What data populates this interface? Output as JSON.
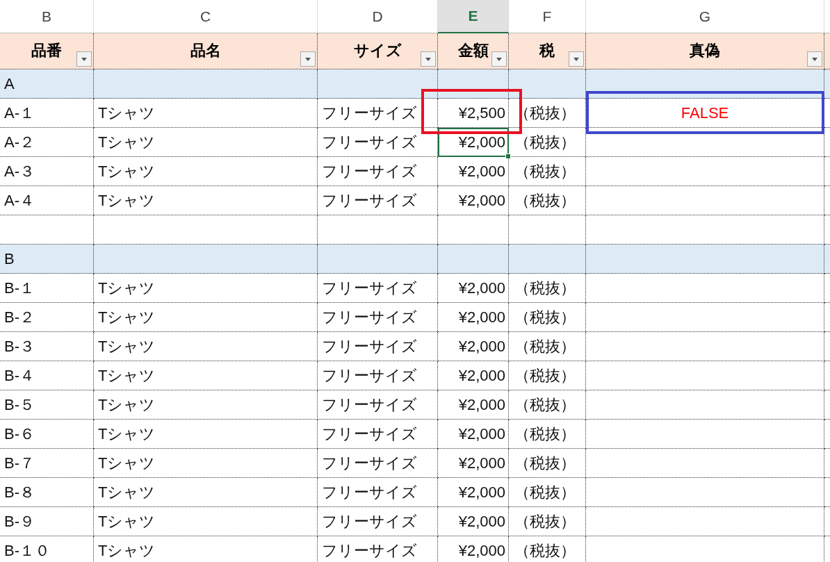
{
  "column_letters": [
    {
      "label": "B",
      "selected": false
    },
    {
      "label": "C",
      "selected": false
    },
    {
      "label": "D",
      "selected": false
    },
    {
      "label": "E",
      "selected": true
    },
    {
      "label": "F",
      "selected": false
    },
    {
      "label": "G",
      "selected": false
    }
  ],
  "headers": [
    {
      "label": "品番",
      "filter": true
    },
    {
      "label": "品名",
      "filter": true
    },
    {
      "label": "サイズ",
      "filter": true
    },
    {
      "label": "金額",
      "filter": true
    },
    {
      "label": "税",
      "filter": true
    },
    {
      "label": "真偽",
      "filter": true
    }
  ],
  "rows": [
    {
      "kind": "group",
      "label": "A"
    },
    {
      "kind": "item",
      "code": "A-１",
      "name": "Tシャツ",
      "size": "フリーサイズ",
      "price": "¥2,500",
      "tax": "（税抜）",
      "truth": "FALSE",
      "price_selected": false,
      "price_frame": true,
      "truth_frame": true
    },
    {
      "kind": "item",
      "code": "A-２",
      "name": "Tシャツ",
      "size": "フリーサイズ",
      "price": "¥2,000",
      "tax": "（税抜）",
      "price_selected": true,
      "price_frame": false,
      "truth_frame": false
    },
    {
      "kind": "item",
      "code": "A-３",
      "name": "Tシャツ",
      "size": "フリーサイズ",
      "price": "¥2,000",
      "tax": "（税抜）",
      "price_selected": false,
      "price_frame": false,
      "truth_frame": false
    },
    {
      "kind": "item",
      "code": "A-４",
      "name": "Tシャツ",
      "size": "フリーサイズ",
      "price": "¥2,000",
      "tax": "（税抜）",
      "price_selected": false,
      "price_frame": false,
      "truth_frame": false
    },
    {
      "kind": "blank"
    },
    {
      "kind": "group",
      "label": "B"
    },
    {
      "kind": "item",
      "code": "B-１",
      "name": "Tシャツ",
      "size": "フリーサイズ",
      "price": "¥2,000",
      "tax": "（税抜）",
      "price_selected": false,
      "price_frame": false,
      "truth_frame": false
    },
    {
      "kind": "item",
      "code": "B-２",
      "name": "Tシャツ",
      "size": "フリーサイズ",
      "price": "¥2,000",
      "tax": "（税抜）",
      "price_selected": false,
      "price_frame": false,
      "truth_frame": false
    },
    {
      "kind": "item",
      "code": "B-３",
      "name": "Tシャツ",
      "size": "フリーサイズ",
      "price": "¥2,000",
      "tax": "（税抜）",
      "price_selected": false,
      "price_frame": false,
      "truth_frame": false
    },
    {
      "kind": "item",
      "code": "B-４",
      "name": "Tシャツ",
      "size": "フリーサイズ",
      "price": "¥2,000",
      "tax": "（税抜）",
      "price_selected": false,
      "price_frame": false,
      "truth_frame": false
    },
    {
      "kind": "item",
      "code": "B-５",
      "name": "Tシャツ",
      "size": "フリーサイズ",
      "price": "¥2,000",
      "tax": "（税抜）",
      "price_selected": false,
      "price_frame": false,
      "truth_frame": false
    },
    {
      "kind": "item",
      "code": "B-６",
      "name": "Tシャツ",
      "size": "フリーサイズ",
      "price": "¥2,000",
      "tax": "（税抜）",
      "price_selected": false,
      "price_frame": false,
      "truth_frame": false
    },
    {
      "kind": "item",
      "code": "B-７",
      "name": "Tシャツ",
      "size": "フリーサイズ",
      "price": "¥2,000",
      "tax": "（税抜）",
      "price_selected": false,
      "price_frame": false,
      "truth_frame": false
    },
    {
      "kind": "item",
      "code": "B-８",
      "name": "Tシャツ",
      "size": "フリーサイズ",
      "price": "¥2,000",
      "tax": "（税抜）",
      "price_selected": false,
      "price_frame": false,
      "truth_frame": false
    },
    {
      "kind": "item",
      "code": "B-９",
      "name": "Tシャツ",
      "size": "フリーサイズ",
      "price": "¥2,000",
      "tax": "（税抜）",
      "price_selected": false,
      "price_frame": false,
      "truth_frame": false
    },
    {
      "kind": "item",
      "code": "B-１０",
      "name": "Tシャツ",
      "size": "フリーサイズ",
      "price": "¥2,000",
      "tax": "（税抜）",
      "price_selected": false,
      "price_frame": false,
      "truth_frame": false
    }
  ]
}
